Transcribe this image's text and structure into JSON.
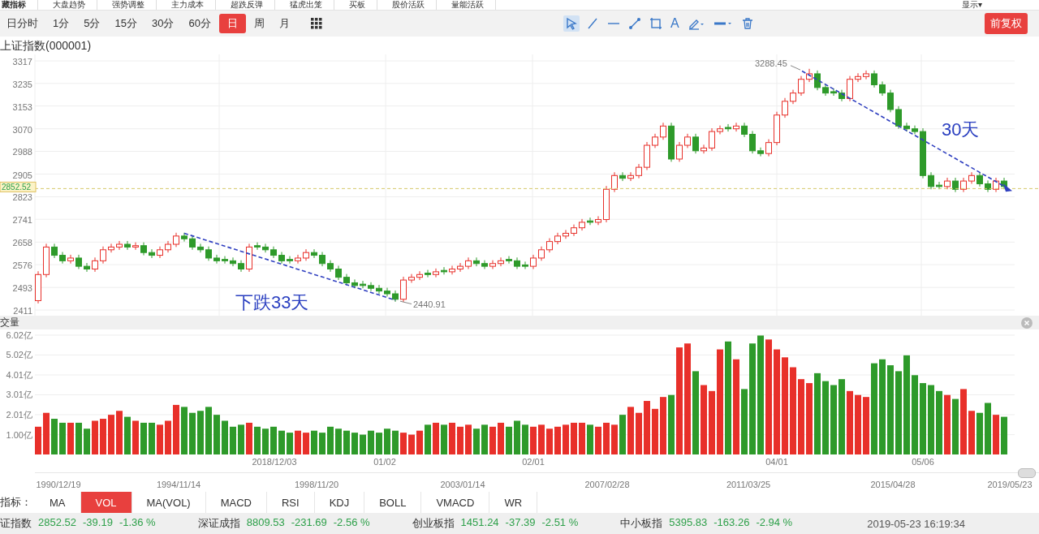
{
  "top_tabs": [
    "藏指标",
    "大盘趋势",
    "强势调整",
    "主力成本",
    "超跌反弹",
    "猛虎出笼",
    "买板",
    "股价活跃",
    "量能活跃"
  ],
  "top_right": {
    "display_menu": "显示▾"
  },
  "periods": [
    {
      "label": "日分时",
      "selected": false
    },
    {
      "label": "1分",
      "selected": false
    },
    {
      "label": "5分",
      "selected": false
    },
    {
      "label": "15分",
      "selected": false
    },
    {
      "label": "30分",
      "selected": false
    },
    {
      "label": "60分",
      "selected": false
    },
    {
      "label": "日",
      "selected": true
    },
    {
      "label": "周",
      "selected": false
    },
    {
      "label": "月",
      "selected": false
    }
  ],
  "draw_tools": [
    {
      "kind": "cursor",
      "selected": true
    },
    {
      "kind": "line",
      "selected": false
    },
    {
      "kind": "hline",
      "selected": false
    },
    {
      "kind": "segment",
      "selected": false
    },
    {
      "kind": "rect",
      "selected": false
    },
    {
      "kind": "text",
      "label": "A",
      "selected": false
    },
    {
      "kind": "pen",
      "selected": false
    },
    {
      "kind": "style",
      "selected": false
    },
    {
      "kind": "trash",
      "selected": false
    }
  ],
  "adjust_button": "前复权",
  "price_chart": {
    "title": "上证指数(000001)",
    "high_label": "3288.45",
    "low_label": "2440.91",
    "trends": [
      {
        "text": "下跌33天",
        "arrow": false
      },
      {
        "text": "30天",
        "arrow": true
      }
    ],
    "chart_data": {
      "type": "candlestick",
      "grid": true,
      "ylim": [
        2411,
        3317
      ],
      "yticks": [
        3317,
        3235,
        3153,
        3070,
        2988,
        2905,
        2823,
        2741,
        2658,
        2576,
        2493,
        2411
      ],
      "ref_lines": [
        {
          "axis": "y",
          "value": 2852.52,
          "label": "2852.52"
        }
      ],
      "ohlc": [
        [
          2445,
          2552,
          2435,
          2540
        ],
        [
          2540,
          2652,
          2530,
          2640
        ],
        [
          2640,
          2652,
          2600,
          2610
        ],
        [
          2610,
          2622,
          2580,
          2590
        ],
        [
          2590,
          2612,
          2580,
          2600
        ],
        [
          2600,
          2612,
          2560,
          2570
        ],
        [
          2570,
          2582,
          2550,
          2560
        ],
        [
          2560,
          2602,
          2550,
          2590
        ],
        [
          2590,
          2642,
          2580,
          2630
        ],
        [
          2630,
          2652,
          2620,
          2640
        ],
        [
          2640,
          2662,
          2630,
          2650
        ],
        [
          2650,
          2662,
          2630,
          2640
        ],
        [
          2640,
          2657,
          2630,
          2645
        ],
        [
          2645,
          2657,
          2610,
          2620
        ],
        [
          2620,
          2632,
          2600,
          2610
        ],
        [
          2610,
          2642,
          2600,
          2630
        ],
        [
          2630,
          2662,
          2620,
          2650
        ],
        [
          2650,
          2692,
          2640,
          2680
        ],
        [
          2680,
          2692,
          2660,
          2670
        ],
        [
          2670,
          2682,
          2630,
          2640
        ],
        [
          2640,
          2652,
          2620,
          2630
        ],
        [
          2630,
          2642,
          2590,
          2600
        ],
        [
          2600,
          2612,
          2580,
          2590
        ],
        [
          2595,
          2607,
          2580,
          2590
        ],
        [
          2590,
          2602,
          2570,
          2580
        ],
        [
          2580,
          2592,
          2550,
          2560
        ],
        [
          2560,
          2652,
          2550,
          2640
        ],
        [
          2645,
          2657,
          2630,
          2640
        ],
        [
          2640,
          2652,
          2620,
          2630
        ],
        [
          2630,
          2642,
          2600,
          2610
        ],
        [
          2610,
          2622,
          2580,
          2590
        ],
        [
          2595,
          2607,
          2580,
          2590
        ],
        [
          2590,
          2612,
          2580,
          2600
        ],
        [
          2600,
          2632,
          2590,
          2620
        ],
        [
          2620,
          2632,
          2600,
          2610
        ],
        [
          2610,
          2622,
          2570,
          2580
        ],
        [
          2580,
          2592,
          2550,
          2560
        ],
        [
          2560,
          2572,
          2520,
          2530
        ],
        [
          2530,
          2542,
          2500,
          2510
        ],
        [
          2510,
          2522,
          2490,
          2500
        ],
        [
          2505,
          2517,
          2490,
          2500
        ],
        [
          2500,
          2512,
          2480,
          2490
        ],
        [
          2490,
          2502,
          2470,
          2480
        ],
        [
          2480,
          2492,
          2460,
          2470
        ],
        [
          2470,
          2482,
          2441,
          2450
        ],
        [
          2450,
          2532,
          2440,
          2520
        ],
        [
          2520,
          2542,
          2510,
          2530
        ],
        [
          2530,
          2552,
          2520,
          2540
        ],
        [
          2545,
          2557,
          2530,
          2540
        ],
        [
          2540,
          2562,
          2530,
          2550
        ],
        [
          2555,
          2567,
          2540,
          2550
        ],
        [
          2550,
          2572,
          2540,
          2560
        ],
        [
          2560,
          2582,
          2550,
          2570
        ],
        [
          2570,
          2602,
          2560,
          2590
        ],
        [
          2590,
          2602,
          2570,
          2580
        ],
        [
          2580,
          2592,
          2560,
          2570
        ],
        [
          2570,
          2592,
          2560,
          2580
        ],
        [
          2580,
          2602,
          2570,
          2590
        ],
        [
          2595,
          2607,
          2580,
          2590
        ],
        [
          2590,
          2602,
          2560,
          2570
        ],
        [
          2575,
          2587,
          2560,
          2570
        ],
        [
          2570,
          2612,
          2560,
          2600
        ],
        [
          2600,
          2642,
          2590,
          2630
        ],
        [
          2630,
          2672,
          2620,
          2660
        ],
        [
          2660,
          2692,
          2650,
          2680
        ],
        [
          2680,
          2702,
          2670,
          2690
        ],
        [
          2690,
          2722,
          2680,
          2710
        ],
        [
          2710,
          2742,
          2700,
          2730
        ],
        [
          2735,
          2747,
          2720,
          2730
        ],
        [
          2730,
          2752,
          2720,
          2740
        ],
        [
          2740,
          2862,
          2730,
          2850
        ],
        [
          2850,
          2912,
          2840,
          2900
        ],
        [
          2900,
          2912,
          2880,
          2890
        ],
        [
          2890,
          2912,
          2880,
          2900
        ],
        [
          2900,
          2942,
          2890,
          2930
        ],
        [
          2930,
          3022,
          2920,
          3010
        ],
        [
          3010,
          3052,
          3000,
          3040
        ],
        [
          3040,
          3092,
          3030,
          3080
        ],
        [
          3080,
          3092,
          2950,
          2960
        ],
        [
          2960,
          3022,
          2950,
          3010
        ],
        [
          3010,
          3052,
          3000,
          3040
        ],
        [
          3040,
          3052,
          2980,
          2990
        ],
        [
          2990,
          3012,
          2980,
          3000
        ],
        [
          3000,
          3072,
          2990,
          3060
        ],
        [
          3060,
          3082,
          3050,
          3070
        ],
        [
          3075,
          3087,
          3060,
          3070
        ],
        [
          3070,
          3092,
          3060,
          3080
        ],
        [
          3080,
          3092,
          3040,
          3050
        ],
        [
          3050,
          3062,
          2980,
          2990
        ],
        [
          2990,
          3002,
          2970,
          2980
        ],
        [
          2980,
          3032,
          2970,
          3020
        ],
        [
          3020,
          3132,
          3010,
          3120
        ],
        [
          3120,
          3182,
          3110,
          3170
        ],
        [
          3170,
          3212,
          3160,
          3200
        ],
        [
          3200,
          3262,
          3190,
          3250
        ],
        [
          3250,
          3288,
          3240,
          3270
        ],
        [
          3270,
          3282,
          3210,
          3220
        ],
        [
          3220,
          3232,
          3190,
          3200
        ],
        [
          3205,
          3217,
          3190,
          3200
        ],
        [
          3200,
          3212,
          3170,
          3180
        ],
        [
          3180,
          3262,
          3170,
          3250
        ],
        [
          3250,
          3272,
          3240,
          3260
        ],
        [
          3260,
          3282,
          3250,
          3270
        ],
        [
          3270,
          3282,
          3220,
          3230
        ],
        [
          3230,
          3242,
          3190,
          3200
        ],
        [
          3200,
          3212,
          3130,
          3140
        ],
        [
          3140,
          3152,
          3070,
          3080
        ],
        [
          3080,
          3092,
          3060,
          3070
        ],
        [
          3070,
          3082,
          3050,
          3060
        ],
        [
          3060,
          3072,
          2890,
          2900
        ],
        [
          2900,
          2912,
          2850,
          2860
        ],
        [
          2865,
          2877,
          2850,
          2860
        ],
        [
          2860,
          2892,
          2850,
          2880
        ],
        [
          2880,
          2892,
          2840,
          2850
        ],
        [
          2850,
          2892,
          2840,
          2880
        ],
        [
          2880,
          2912,
          2870,
          2900
        ],
        [
          2900,
          2912,
          2860,
          2870
        ],
        [
          2870,
          2882,
          2840,
          2850
        ],
        [
          2850,
          2892,
          2840,
          2880
        ],
        [
          2880,
          2892,
          2850,
          2860
        ]
      ]
    }
  },
  "volume_panel": {
    "upper_dates": [
      "2018/12/03",
      "01/02",
      "02/01",
      "04/01",
      "05/06"
    ],
    "date_labels": [
      "1990/12/19",
      "1994/11/14",
      "1998/11/20",
      "2003/01/14",
      "2007/02/28",
      "2011/03/25",
      "2015/04/28",
      "2019/05/23"
    ],
    "chart_data": {
      "type": "bar",
      "grid": true,
      "ylim": [
        0,
        6.1
      ],
      "yticks": [
        {
          "value": 1.0,
          "label": "1.00亿"
        },
        {
          "value": 2.01,
          "label": "2.01亿"
        },
        {
          "value": 3.01,
          "label": "3.01亿"
        },
        {
          "value": 4.01,
          "label": "4.01亿"
        },
        {
          "value": 5.02,
          "label": "5.02亿"
        },
        {
          "value": 6.02,
          "label": "6.02亿"
        }
      ],
      "series": [
        {
          "name": "交量",
          "values": [
            1.4,
            2.1,
            1.8,
            1.6,
            1.6,
            1.6,
            1.3,
            1.7,
            1.8,
            2.0,
            2.2,
            1.9,
            1.7,
            1.6,
            1.6,
            1.5,
            1.7,
            2.5,
            2.4,
            2.1,
            2.2,
            2.4,
            2.0,
            1.7,
            1.4,
            1.5,
            1.6,
            1.4,
            1.3,
            1.4,
            1.2,
            1.1,
            1.2,
            1.1,
            1.2,
            1.1,
            1.4,
            1.3,
            1.2,
            1.1,
            1.0,
            1.2,
            1.1,
            1.3,
            1.2,
            1.1,
            1.0,
            1.2,
            1.5,
            1.6,
            1.5,
            1.6,
            1.4,
            1.5,
            1.3,
            1.5,
            1.4,
            1.6,
            1.4,
            1.7,
            1.5,
            1.4,
            1.5,
            1.3,
            1.4,
            1.5,
            1.6,
            1.6,
            1.5,
            1.4,
            1.6,
            1.5,
            2.0,
            2.4,
            2.1,
            2.7,
            2.3,
            2.9,
            3.0,
            5.4,
            5.6,
            4.2,
            3.5,
            3.2,
            5.3,
            5.7,
            4.8,
            3.3,
            5.6,
            6.0,
            5.8,
            5.3,
            4.9,
            4.4,
            3.8,
            3.6,
            4.1,
            3.7,
            3.5,
            3.8,
            3.2,
            3.0,
            2.9,
            4.6,
            4.8,
            4.5,
            4.2,
            5.0,
            4.0,
            3.6,
            3.5,
            3.2,
            3.0,
            2.8,
            3.3,
            2.2,
            2.1,
            2.6,
            2.0,
            1.9
          ]
        }
      ]
    }
  },
  "indicator_bar": {
    "label": "指标：",
    "tabs": [
      {
        "label": "MA",
        "selected": false
      },
      {
        "label": "VOL",
        "selected": true
      },
      {
        "label": "MA(VOL)",
        "selected": false
      },
      {
        "label": "MACD",
        "selected": false
      },
      {
        "label": "RSI",
        "selected": false
      },
      {
        "label": "KDJ",
        "selected": false
      },
      {
        "label": "BOLL",
        "selected": false
      },
      {
        "label": "VMACD",
        "selected": false
      },
      {
        "label": "WR",
        "selected": false
      }
    ]
  },
  "status_bar": {
    "indices": [
      {
        "name": "证指数",
        "price": "2852.52",
        "change": "-39.19",
        "percent": "-1.36 %"
      },
      {
        "name": "深证成指",
        "price": "8809.53",
        "change": "-231.69",
        "percent": "-2.56 %"
      },
      {
        "name": "创业板指",
        "price": "1451.24",
        "change": "-37.39",
        "percent": "-2.51 %"
      },
      {
        "name": "中小板指",
        "price": "5395.83",
        "change": "-163.26",
        "percent": "-2.94 %"
      }
    ],
    "timestamp": "2019-05-23 16:19:34"
  }
}
